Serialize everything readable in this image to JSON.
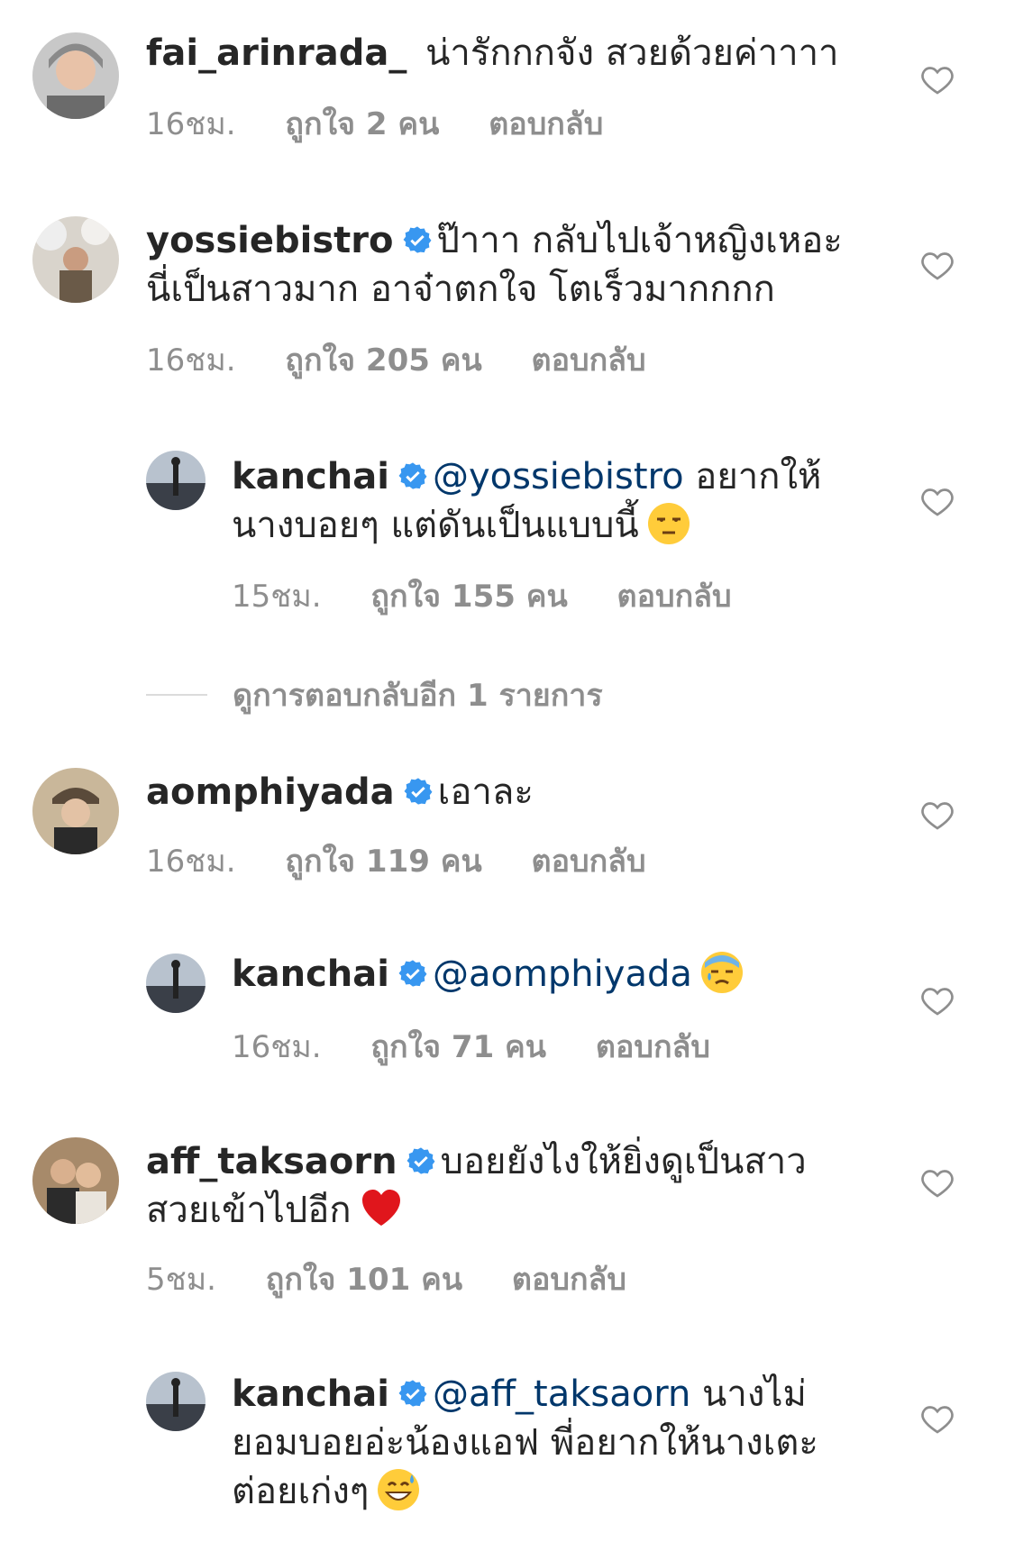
{
  "comments": [
    {
      "username": "fai_arinrada_",
      "verified": false,
      "text": "น่ารักกกจัง สวยด้วยค่าาาา",
      "time": "16ชม.",
      "likes": "ถูกใจ 2 คน",
      "reply": "ตอบกลับ"
    },
    {
      "username": "yossiebistro",
      "verified": true,
      "text": "ป๊าาา กลับไปเจ้าหญิงเหอะ นี่เป็นสาวมาก อาจ๋าตกใจ โตเร็วมากกกก",
      "time": "16ชม.",
      "likes": "ถูกใจ 205 คน",
      "reply": "ตอบกลับ"
    },
    {
      "username": "kanchai",
      "verified": true,
      "mention": "@yossiebistro",
      "text": " อยากให้นางบอยๆ แต่ดันเป็นแบบนี้",
      "emoji": "unamused-face",
      "time": "15ชม.",
      "likes": "ถูกใจ 155 คน",
      "reply": "ตอบกลับ"
    },
    {
      "username": "aomphiyada",
      "verified": true,
      "text": "เอาละ",
      "time": "16ชม.",
      "likes": "ถูกใจ 119 คน",
      "reply": "ตอบกลับ"
    },
    {
      "username": "kanchai",
      "verified": true,
      "mention": "@aomphiyada",
      "text": "",
      "emoji": "downcast-sweat-face",
      "time": "16ชม.",
      "likes": "ถูกใจ 71 คน",
      "reply": "ตอบกลับ"
    },
    {
      "username": "aff_taksaorn",
      "verified": true,
      "text": "บอยยังไงให้ยิ่งดูเป็นสาวสวยเข้าไปอีก",
      "emoji": "red-heart",
      "time": "5ชม.",
      "likes": "ถูกใจ 101 คน",
      "reply": "ตอบกลับ"
    },
    {
      "username": "kanchai",
      "verified": true,
      "mention": "@aff_taksaorn",
      "text": " นางไม่ยอมบอยอ่ะน้องแอฟ พี่อยากให้นางเตะต่อยเก่งๆ",
      "emoji": "grinning-sweat-face"
    }
  ],
  "view_more_replies": "ดูการตอบกลับอีก 1 รายการ",
  "colors": {
    "text": "#262626",
    "meta": "#8e8e8e",
    "mention": "#00376b",
    "verified": "#3897f0"
  }
}
